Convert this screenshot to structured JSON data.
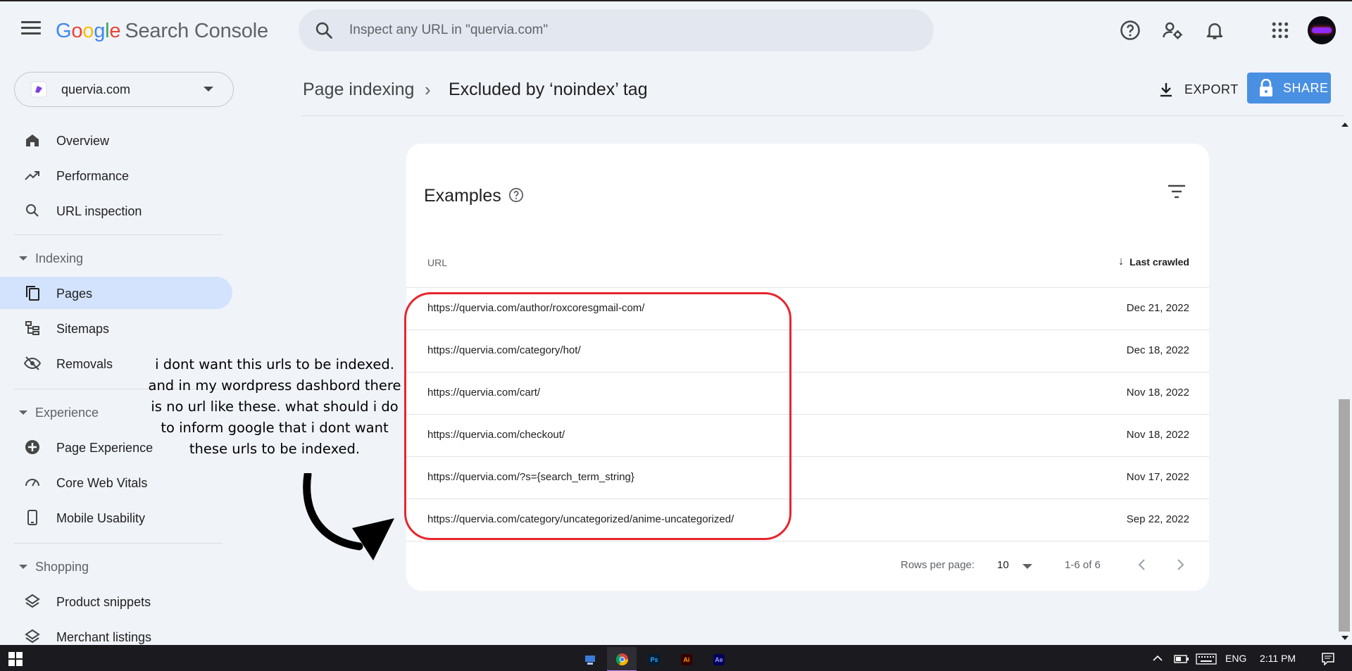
{
  "header": {
    "product_prefix": [
      "G",
      "o",
      "o",
      "g",
      "l",
      "e"
    ],
    "product_name": "Search Console",
    "search_placeholder": "Inspect any URL in \"quervia.com\""
  },
  "property": {
    "name": "quervia.com"
  },
  "sidebar": {
    "top_items": [
      {
        "label": "Overview",
        "icon": "home-icon"
      },
      {
        "label": "Performance",
        "icon": "trending-icon"
      },
      {
        "label": "URL inspection",
        "icon": "search-icon"
      }
    ],
    "sections": [
      {
        "label": "Indexing",
        "items": [
          {
            "label": "Pages",
            "icon": "pages-icon",
            "active": true
          },
          {
            "label": "Sitemaps",
            "icon": "sitemap-icon"
          },
          {
            "label": "Removals",
            "icon": "visibility-off-icon"
          }
        ]
      },
      {
        "label": "Experience",
        "items": [
          {
            "label": "Page Experience",
            "icon": "page-experience-icon"
          },
          {
            "label": "Core Web Vitals",
            "icon": "speed-icon"
          },
          {
            "label": "Mobile Usability",
            "icon": "phone-icon"
          }
        ]
      },
      {
        "label": "Shopping",
        "items": [
          {
            "label": "Product snippets",
            "icon": "layers-icon"
          },
          {
            "label": "Merchant listings",
            "icon": "layers-icon"
          }
        ]
      }
    ]
  },
  "breadcrumb": {
    "parent": "Page indexing",
    "separator": "›",
    "current": "Excluded by ‘noindex’ tag"
  },
  "actions": {
    "export_label": "EXPORT",
    "share_label": "SHARE"
  },
  "examples": {
    "title": "Examples",
    "columns": {
      "url": "URL",
      "last_crawled": "Last crawled"
    },
    "rows": [
      {
        "url": "https://quervia.com/author/roxcoresgmail-com/",
        "date": "Dec 21, 2022"
      },
      {
        "url": "https://quervia.com/category/hot/",
        "date": "Dec 18, 2022"
      },
      {
        "url": "https://quervia.com/cart/",
        "date": "Nov 18, 2022"
      },
      {
        "url": "https://quervia.com/checkout/",
        "date": "Nov 18, 2022"
      },
      {
        "url": "https://quervia.com/?s={search_term_string}",
        "date": "Nov 17, 2022"
      },
      {
        "url": "https://quervia.com/category/uncategorized/anime-uncategorized/",
        "date": "Sep 22, 2022"
      }
    ],
    "pagination": {
      "rows_per_page_label": "Rows per page:",
      "rows_per_page": "10",
      "range": "1-6 of 6"
    }
  },
  "annotation": {
    "text": "i dont want this urls to be indexed. and in my wordpress dashbord there is no url like these. what should i do to inform google that i dont want these urls to be indexed.",
    "color": "#e6262e"
  },
  "taskbar": {
    "apps": [
      {
        "name": "desktop-app",
        "label": ""
      },
      {
        "name": "chrome",
        "label": ""
      },
      {
        "name": "photoshop",
        "label": "Ps"
      },
      {
        "name": "illustrator",
        "label": "Ai"
      },
      {
        "name": "after-effects",
        "label": "Ae"
      }
    ],
    "language": "ENG",
    "time": "2:11 PM"
  },
  "colors": {
    "accent": "#4a90e2",
    "active_nav": "#d3e3fd",
    "background": "#f0f4f9"
  }
}
